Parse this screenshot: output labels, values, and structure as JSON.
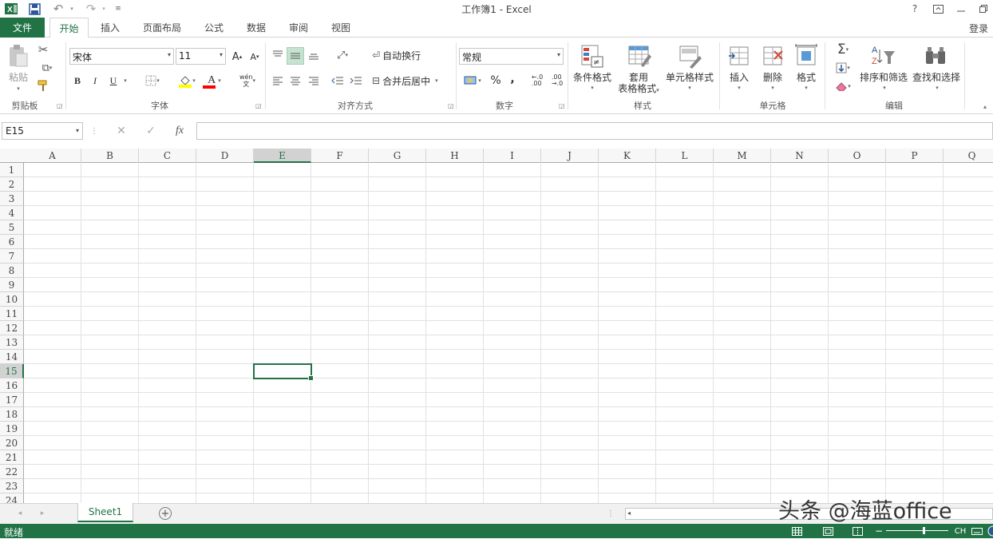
{
  "titlebar": {
    "title": "工作簿1 - Excel",
    "help": "?",
    "colors": {
      "brand": "#217346"
    }
  },
  "tabs": {
    "file": "文件",
    "items": [
      "开始",
      "插入",
      "页面布局",
      "公式",
      "数据",
      "审阅",
      "视图"
    ],
    "active": "开始",
    "login": "登录"
  },
  "ribbon": {
    "clipboard": {
      "paste": "粘贴",
      "group": "剪贴板"
    },
    "font": {
      "name": "宋体",
      "size": "11",
      "grow": "A",
      "shrink": "A",
      "bold": "B",
      "italic": "I",
      "underline": "U",
      "color_a": "A",
      "wen": "wén\n文",
      "group": "字体"
    },
    "align": {
      "wrap": "自动换行",
      "merge": "合并后居中",
      "group": "对齐方式"
    },
    "number": {
      "format": "常规",
      "percent": "%",
      "comma": ",",
      "group": "数字"
    },
    "styles": {
      "conditional": "条件格式",
      "table_format_1": "套用",
      "table_format_2": "表格格式",
      "cell_style": "单元格样式",
      "group": "样式"
    },
    "cells": {
      "insert": "插入",
      "delete": "删除",
      "format": "格式",
      "group": "单元格"
    },
    "editing": {
      "sort_filter": "排序和筛选",
      "find_select": "查找和选择",
      "group": "编辑"
    }
  },
  "formulabar": {
    "namebox": "E15",
    "fx": "fx",
    "value": ""
  },
  "grid": {
    "columns": [
      "A",
      "B",
      "C",
      "D",
      "E",
      "F",
      "G",
      "H",
      "I",
      "J",
      "K",
      "L",
      "M",
      "N",
      "O",
      "P",
      "Q"
    ],
    "rows": [
      "1",
      "2",
      "3",
      "4",
      "5",
      "6",
      "7",
      "8",
      "9",
      "10",
      "11",
      "12",
      "13",
      "14",
      "15",
      "16",
      "17",
      "18",
      "19",
      "20",
      "21",
      "22",
      "23",
      "24"
    ],
    "active_col": "E",
    "active_row": "15"
  },
  "sheets": {
    "tabs": [
      "Sheet1"
    ],
    "active": "Sheet1",
    "add": "+"
  },
  "watermark": "头条 @海蓝office",
  "statusbar": {
    "text": "就绪",
    "ime": "CH"
  }
}
